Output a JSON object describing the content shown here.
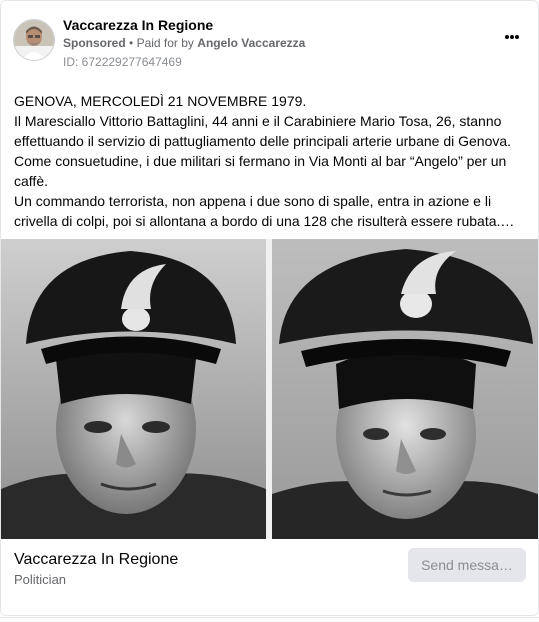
{
  "post": {
    "page_name": "Vaccarezza In Regione",
    "sponsored_label": "Sponsored",
    "separator": "•",
    "paid_for_label": "Paid for by",
    "payer_name": "Angelo Vaccarezza",
    "ad_id": "ID: 672229277647469",
    "more_icon": "more-horizontal-icon",
    "body": [
      "GENOVA, MERCOLEDÌ 21 NOVEMBRE 1979.",
      "Il Maresciallo Vittorio Battaglini, 44 anni e il Carabiniere Mario Tosa, 26, stanno effettuando il servizio di pattugliamento delle principali arterie urbane di Genova.",
      "Come consuetudine, i due militari si fermano in Via Monti al bar “Angelo” per un caffè.",
      "Un commando terrorista, non appena i due sono di spalle, entra in azione e li crivella di colpi, poi si allontana a bordo di una 128 che risulterà essere rubata.…"
    ],
    "image": "black-and-white photograph of two carabinieri in uniform caps"
  },
  "footer": {
    "page_name": "Vaccarezza In Regione",
    "category": "Politician",
    "send_button": "Send messa…"
  }
}
